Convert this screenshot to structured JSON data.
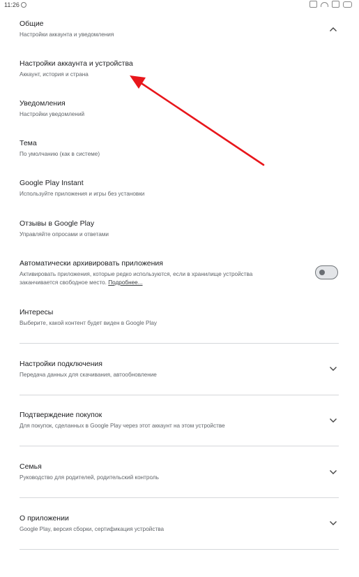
{
  "status_bar": {
    "time": "11:26"
  },
  "sections": [
    {
      "title": "Общие",
      "subtitle": "Настройки аккаунта и уведомления"
    },
    {
      "title": "Настройки аккаунта и устройства",
      "subtitle": "Аккаунт, история и страна"
    },
    {
      "title": "Уведомления",
      "subtitle": "Настройки уведомлений"
    },
    {
      "title": "Тема",
      "subtitle": "По умолчанию (как в системе)"
    },
    {
      "title": "Google Play Instant",
      "subtitle": "Используйте приложения и игры без установки"
    },
    {
      "title": "Отзывы в Google Play",
      "subtitle": "Управляйте опросами и ответами"
    },
    {
      "title": "Автоматически архивировать приложения",
      "subtitle": "Активировать приложения, которые редко используются, если в хранилище устройства заканчивается свободное место.",
      "link": "Подробнее...",
      "toggle_on": false
    },
    {
      "title": "Интересы",
      "subtitle": "Выберите, какой контент будет виден в Google Play"
    },
    {
      "title": "Настройки подключения",
      "subtitle": "Передача данных для скачивания, автообновление"
    },
    {
      "title": "Подтверждение покупок",
      "subtitle": "Для покупок, сделанных в Google Play через этот аккаунт на этом устройстве"
    },
    {
      "title": "Семья",
      "subtitle": "Руководство для родителей, родительский контроль"
    },
    {
      "title": "О приложении",
      "subtitle": "Google Play, версия сборки, сертификация устройства"
    }
  ],
  "colors": {
    "annotation_arrow": "#e8161b",
    "divider": "#d5d7da",
    "text_primary": "#202124",
    "text_secondary": "#5f6368"
  },
  "icons": {
    "expanded": "chevron-up-icon",
    "collapsed": "chevron-down-icon"
  }
}
